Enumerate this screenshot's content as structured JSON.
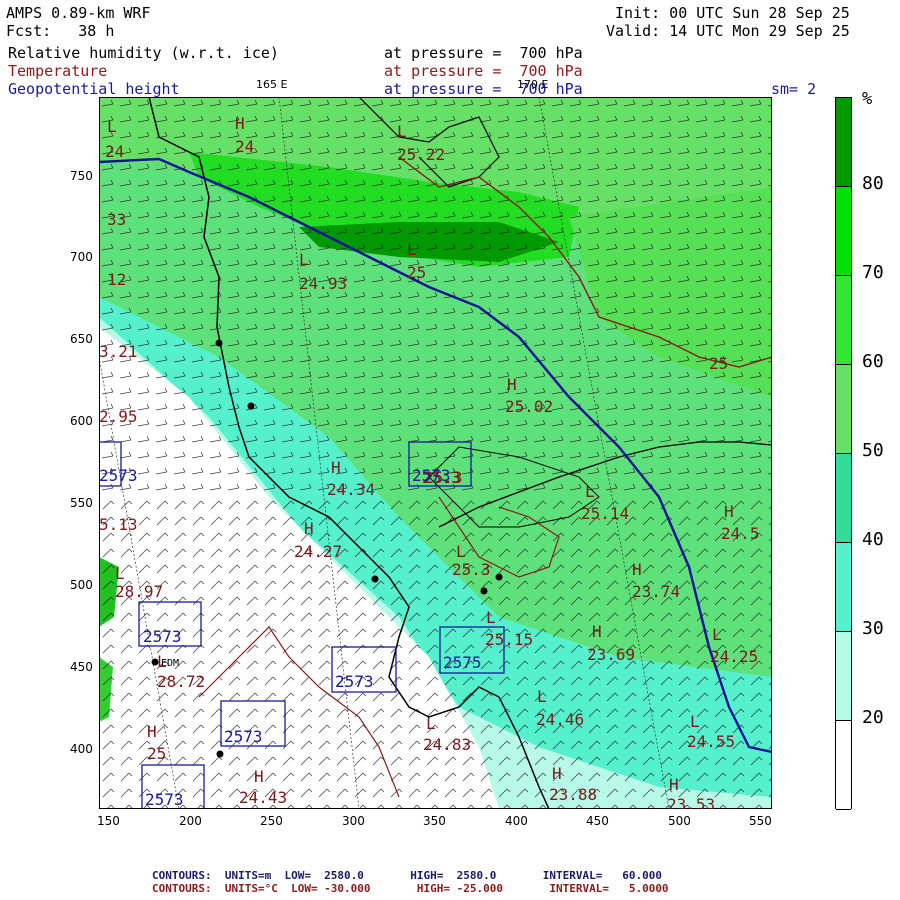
{
  "header": {
    "model": "AMPS 0.89-km WRF",
    "forecast": "Fcst:   38 h",
    "init": "Init: 00 UTC Sun 28 Sep 25",
    "valid": "Valid: 14 UTC Mon 29 Sep 25",
    "fields": [
      {
        "name": "Relative humidity (w.r.t. ice)",
        "level": "at pressure =  700 hPa",
        "color": "#000000"
      },
      {
        "name": "Temperature",
        "level": "at pressure =  700 hPa",
        "color": "#8b1a1a"
      },
      {
        "name": "Geopotential height",
        "level": "at pressure =  700 hPa",
        "color": "#1a1a99"
      }
    ],
    "smoothing": "sm= 2",
    "meridians": [
      "165 E",
      "170 E"
    ]
  },
  "map": {
    "x_ticks": [
      "150",
      "200",
      "250",
      "300",
      "350",
      "400",
      "450",
      "500",
      "550"
    ],
    "y_ticks": [
      "750",
      "700",
      "650",
      "600",
      "550",
      "500",
      "450",
      "400"
    ],
    "temp_labels": [
      {
        "text": "L",
        "id": "t1"
      },
      {
        "text": "24",
        "id": "t2"
      },
      {
        "text": "H",
        "id": "t3"
      },
      {
        "text": "24",
        "id": "t4"
      },
      {
        "text": "L",
        "id": "t5"
      },
      {
        "text": "25.22",
        "id": "t6"
      },
      {
        "text": "33",
        "id": "t7"
      },
      {
        "text": "L",
        "id": "t8"
      },
      {
        "text": "24.93",
        "id": "t9"
      },
      {
        "text": "L",
        "id": "t10"
      },
      {
        "text": "25",
        "id": "t11"
      },
      {
        "text": "12",
        "id": "t12"
      },
      {
        "text": "3.21",
        "id": "t13"
      },
      {
        "text": "25",
        "id": "t14"
      },
      {
        "text": "H",
        "id": "t15"
      },
      {
        "text": "25.02",
        "id": "t16"
      },
      {
        "text": "2.95",
        "id": "t17"
      },
      {
        "text": "H",
        "id": "t18"
      },
      {
        "text": "24.34",
        "id": "t19"
      },
      {
        "text": "25.3",
        "id": "t20"
      },
      {
        "text": "25.3",
        "id": "t21"
      },
      {
        "text": "L",
        "id": "t22"
      },
      {
        "text": "25.14",
        "id": "t23"
      },
      {
        "text": "5.13",
        "id": "t24"
      },
      {
        "text": "H",
        "id": "t25"
      },
      {
        "text": "24.27",
        "id": "t26"
      },
      {
        "text": "H",
        "id": "t27"
      },
      {
        "text": "24.5",
        "id": "t28"
      },
      {
        "text": "L",
        "id": "t29"
      },
      {
        "text": "25.3",
        "id": "t30"
      },
      {
        "text": "L",
        "id": "t31"
      },
      {
        "text": "28.97",
        "id": "t32"
      },
      {
        "text": "H",
        "id": "t33"
      },
      {
        "text": "23.74",
        "id": "t34"
      },
      {
        "text": "L",
        "id": "t35"
      },
      {
        "text": "25.15",
        "id": "t36"
      },
      {
        "text": "H",
        "id": "t37"
      },
      {
        "text": "23.69",
        "id": "t38"
      },
      {
        "text": "L",
        "id": "t39"
      },
      {
        "text": "24.25",
        "id": "t40"
      },
      {
        "text": "L",
        "id": "t41"
      },
      {
        "text": "28.72",
        "id": "t42"
      },
      {
        "text": "L",
        "id": "t43"
      },
      {
        "text": "24.46",
        "id": "t44"
      },
      {
        "text": "L",
        "id": "t45"
      },
      {
        "text": "24.83",
        "id": "t46"
      },
      {
        "text": "L",
        "id": "t47"
      },
      {
        "text": "24.55",
        "id": "t48"
      },
      {
        "text": "H",
        "id": "t49"
      },
      {
        "text": "25",
        "id": "t50"
      },
      {
        "text": "H",
        "id": "t51"
      },
      {
        "text": "24.43",
        "id": "t52"
      },
      {
        "text": "H",
        "id": "t53"
      },
      {
        "text": "23.88",
        "id": "t54"
      },
      {
        "text": "H",
        "id": "t55"
      },
      {
        "text": "23.53",
        "id": "t56"
      }
    ],
    "height_labels": [
      {
        "text": "2573",
        "id": "h1"
      },
      {
        "text": "2573",
        "id": "h2"
      },
      {
        "text": "2573",
        "id": "h3"
      },
      {
        "text": "2575",
        "id": "h4"
      },
      {
        "text": "2573",
        "id": "h5"
      },
      {
        "text": "2573",
        "id": "h6"
      },
      {
        "text": "2573",
        "id": "h7"
      }
    ],
    "station": "EDM"
  },
  "colorbar": {
    "unit": "%",
    "labels": [
      "80",
      "70",
      "60",
      "50",
      "40",
      "30",
      "20"
    ],
    "colors": [
      "#009a00",
      "#00e000",
      "#33e633",
      "#66e066",
      "#33dd99",
      "#55f0cc",
      "#b8fae8",
      "#ffffff"
    ]
  },
  "footer": {
    "line1": "CONTOURS:  UNITS=m  LOW=  2580.0       HIGH=  2580.0       INTERVAL=   60.000",
    "line2": "CONTOURS:  UNITS=°C  LOW= -30.000       HIGH= -25.000       INTERVAL=   5.0000",
    "line1_color": "#1a1a66",
    "line2_color": "#8b1a1a"
  }
}
